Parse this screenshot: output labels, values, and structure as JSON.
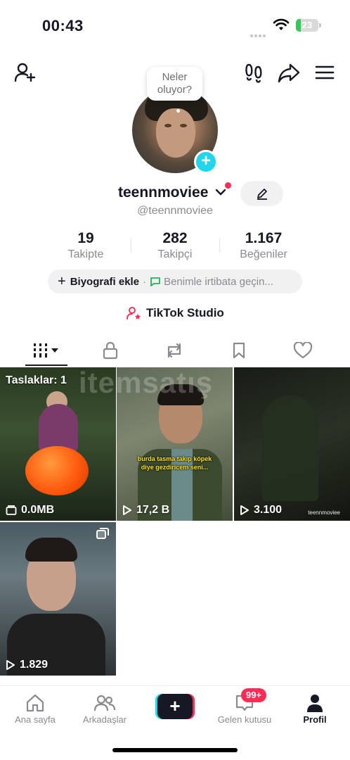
{
  "status_bar": {
    "time": "00:43",
    "battery": "23",
    "battery_level": 0.23
  },
  "header": {
    "bubble_text": "Neler\noluyor?"
  },
  "profile": {
    "username": "teennmoviee",
    "handle": "@teennmoviee",
    "stats": [
      {
        "value": "19",
        "label": "Takipte"
      },
      {
        "value": "282",
        "label": "Takipçi"
      },
      {
        "value": "1.167",
        "label": "Beğeniler"
      }
    ],
    "bio_label": "Biyografi ekle",
    "bio_separator": "·",
    "contact_label": "Benimle irtibata geçin...",
    "studio_label": "TikTok Studio"
  },
  "videos": [
    {
      "overlay": "Taslaklar: 1",
      "meta": "0.0MB",
      "meta_icon": "drafts-icon"
    },
    {
      "subtitle": "burda tasma takıp köpek\ndiye gezdiricem seni...",
      "meta": "17,2 B",
      "meta_icon": "play-icon"
    },
    {
      "meta": "3.100",
      "watermark": "teennmoviee",
      "meta_icon": "play-icon"
    },
    {
      "meta": "1.829",
      "meta_icon": "play-icon"
    }
  ],
  "grid_watermark": "itemsatış",
  "nav": {
    "home": "Ana sayfa",
    "friends": "Arkadaşlar",
    "inbox": "Gelen kutusu",
    "inbox_badge": "99+",
    "profile": "Profil"
  },
  "colors": {
    "accent_red": "#fe2c55",
    "accent_cyan": "#20d5ec",
    "text": "#161823",
    "muted": "#8a8b91"
  }
}
